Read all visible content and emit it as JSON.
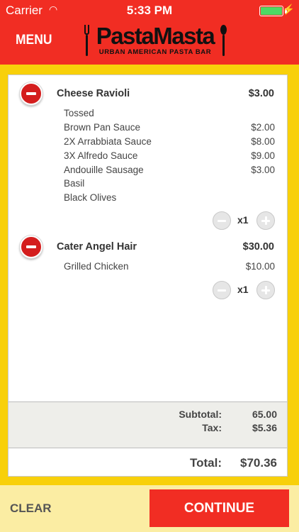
{
  "status_bar": {
    "carrier": "Carrier",
    "time": "5:33 PM",
    "battery": 1.0
  },
  "header": {
    "menu_label": "MENU",
    "logo_name": "PastaMasta",
    "logo_tagline": "URBAN AMERICAN PASTA BAR"
  },
  "colors": {
    "header_red": "#f12d23",
    "background_yellow": "#f8d00a",
    "footer_cream": "#fbeda3",
    "remove_red": "#d41e1e"
  },
  "cart": {
    "items": [
      {
        "name": "Cheese Ravioli",
        "price": "$3.00",
        "quantity": "x1",
        "modifiers": [
          {
            "name": "Tossed",
            "price": ""
          },
          {
            "name": "Brown Pan Sauce",
            "price": "$2.00"
          },
          {
            "name": "2X Arrabbiata Sauce",
            "price": "$8.00"
          },
          {
            "name": "3X Alfredo Sauce",
            "price": "$9.00"
          },
          {
            "name": "Andouille Sausage",
            "price": "$3.00"
          },
          {
            "name": "Basil",
            "price": ""
          },
          {
            "name": "Black Olives",
            "price": ""
          }
        ]
      },
      {
        "name": "Cater Angel Hair",
        "price": "$30.00",
        "quantity": "x1",
        "modifiers": [
          {
            "name": "Grilled Chicken",
            "price": "$10.00"
          }
        ]
      }
    ],
    "totals": {
      "subtotal_label": "Subtotal:",
      "subtotal": "65.00",
      "tax_label": "Tax:",
      "tax": "$5.36",
      "total_label": "Total:",
      "total": "$70.36"
    }
  },
  "footer": {
    "clear_label": "CLEAR",
    "continue_label": "CONTINUE"
  }
}
